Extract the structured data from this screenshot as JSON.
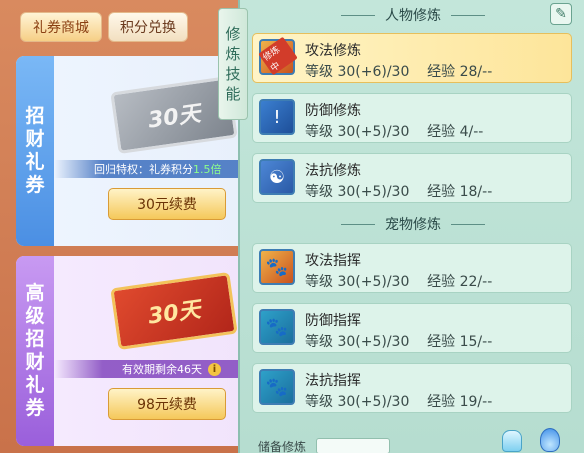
{
  "shop": {
    "tabs": [
      {
        "label": "礼券商城",
        "active": true
      },
      {
        "label": "积分兑换",
        "active": false
      }
    ],
    "cards": [
      {
        "side_label": [
          "招",
          "财",
          "礼",
          "券"
        ],
        "ticket_text": "30天",
        "banner_prefix": "回归特权：礼券积分",
        "banner_highlight": "1.5倍",
        "button": "30元续费"
      },
      {
        "side_label": [
          "高",
          "级",
          "招",
          "财",
          "礼",
          "券"
        ],
        "ticket_text": "30天",
        "banner_prefix": "有效期剩余46天",
        "banner_highlight": "",
        "button": "98元续费",
        "info_icon": "i"
      }
    ]
  },
  "vtab": {
    "label": [
      "修",
      "炼",
      "技",
      "能"
    ]
  },
  "training": {
    "character_title": "人物修炼",
    "pet_title": "宠物修炼",
    "training_badge": "修炼中",
    "character_skills": [
      {
        "name": "攻法修炼",
        "stats": "等级 30(+6)/30    经验 28/--",
        "icon": "attack-icon",
        "active": true
      },
      {
        "name": "防御修炼",
        "stats": "等级 30(+5)/30    经验 4/--",
        "icon": "shield-icon",
        "active": false
      },
      {
        "name": "法抗修炼",
        "stats": "等级 30(+5)/30    经验 18/--",
        "icon": "yinyang-icon",
        "active": false
      }
    ],
    "pet_skills": [
      {
        "name": "攻法指挥",
        "stats": "等级 30(+5)/30    经验 22/--",
        "icon": "paw-attack-icon",
        "active": false
      },
      {
        "name": "防御指挥",
        "stats": "等级 30(+5)/30    经验 15/--",
        "icon": "paw-defense-icon",
        "active": false
      },
      {
        "name": "法抗指挥",
        "stats": "等级 30(+5)/30    经验 19/--",
        "icon": "paw-resist-icon",
        "active": false
      }
    ],
    "reserve_label": "储备修炼"
  },
  "colors": {
    "accent": "#f5c85a",
    "panel": "#c3e6da",
    "active_row": "#fde59a"
  }
}
